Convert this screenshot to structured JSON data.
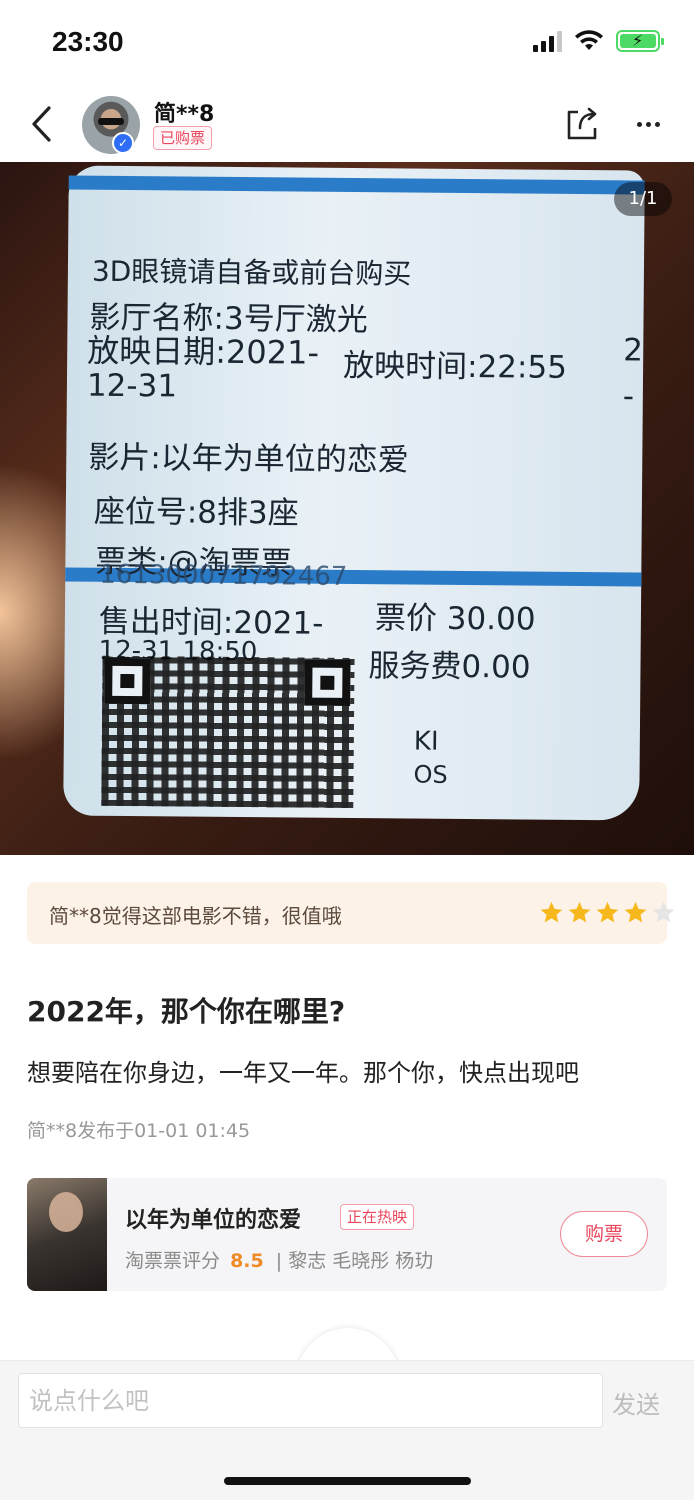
{
  "status_bar": {
    "time": "23:30",
    "battery_color": "#4cd964"
  },
  "header": {
    "username": "简**8",
    "badge": "已购票",
    "icons": [
      "back-chevron-icon",
      "share-icon",
      "more-dots-icon",
      "verified-icon"
    ]
  },
  "photo": {
    "counter": "1/1",
    "ticket_lines": {
      "glasses": "3D眼镜请自备或前台购买",
      "hall": "影厅名称:3号厅激光",
      "date_a": "放映日期:2021-",
      "date_b": "12-31",
      "time": "放映时间:22:55",
      "film": "影片:以年为单位的恋爱",
      "seat": "座位号:8排3座",
      "type": "票类:@淘票票",
      "code": "1613000717924​67",
      "sold_a": "售出时间:2021-",
      "sold_b": "12-31 18:50",
      "price": "票价 30.00",
      "fee": "服务费0.00",
      "kiosk_a": "KI",
      "kiosk_b": "OS",
      "edge_a": "2",
      "edge_b": "-"
    }
  },
  "rating": {
    "text": "简**8觉得这部电影不错，很值哦",
    "stars": 4,
    "max_stars": 5,
    "star_color": "#f6b81c",
    "empty_star_color": "#e5e5e5"
  },
  "post": {
    "title": "2022年，那个你在哪里?",
    "body": "想要陪在你身边，一年又一年。那个你，快点出现吧",
    "meta": "简**8发布于01-01 01:45"
  },
  "movie": {
    "title": "以年为单位的恋爱",
    "status_badge": "正在热映",
    "score_label": "淘票票评分",
    "score": "8.5",
    "cast": "| 黎志 毛晓彤 杨玏",
    "buy_label": "购票",
    "accent": "#e8485e"
  },
  "comment_bar": {
    "placeholder": "说点什么吧",
    "send_label": "发送"
  }
}
